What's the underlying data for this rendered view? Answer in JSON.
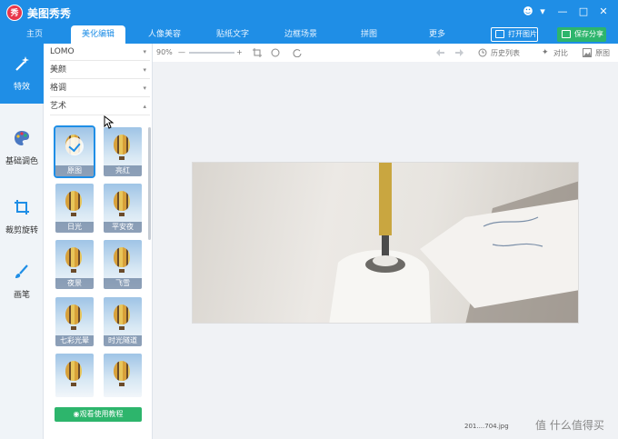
{
  "app": {
    "title": "美图秀秀",
    "logo_text": "秀"
  },
  "window_controls": [
    "☻",
    "▾",
    "—",
    "□",
    "✕"
  ],
  "nav": {
    "tabs": [
      {
        "label": "主页",
        "active": false
      },
      {
        "label": "美化编辑",
        "active": true
      },
      {
        "label": "人像美容",
        "active": false
      },
      {
        "label": "贴纸文字",
        "active": false
      },
      {
        "label": "边框场景",
        "active": false
      },
      {
        "label": "拼图",
        "active": false
      },
      {
        "label": "更多",
        "active": false
      }
    ],
    "open_button": "打开图片",
    "save_button": "保存分享"
  },
  "sidebar": {
    "items": [
      {
        "label": "特效",
        "icon": "magic-wand-icon",
        "active": true
      },
      {
        "label": "基础调色",
        "icon": "palette-icon",
        "active": false
      },
      {
        "label": "裁剪旋转",
        "icon": "crop-icon",
        "active": false
      },
      {
        "label": "画笔",
        "icon": "brush-icon",
        "active": false
      }
    ]
  },
  "panel": {
    "categories": [
      {
        "label": "LOMO",
        "arrow": "▾"
      },
      {
        "label": "美颜",
        "arrow": "▾"
      },
      {
        "label": "格调",
        "arrow": "▾"
      },
      {
        "label": "艺术",
        "arrow": "▴"
      }
    ],
    "effects": [
      {
        "label": "原图",
        "selected": true
      },
      {
        "label": "亮红",
        "selected": false
      },
      {
        "label": "日光",
        "selected": false
      },
      {
        "label": "平安夜",
        "selected": false
      },
      {
        "label": "夜景",
        "selected": false
      },
      {
        "label": "飞雪",
        "selected": false
      },
      {
        "label": "七彩光晕",
        "selected": false
      },
      {
        "label": "时光隧道",
        "selected": false
      },
      {
        "label": "",
        "selected": false
      },
      {
        "label": "",
        "selected": false
      }
    ],
    "tutorial_button": "◉观看使用教程"
  },
  "toolbar": {
    "zoom": "90%",
    "zoom_out": "—",
    "zoom_in": "+",
    "history": "历史列表",
    "compare": "对比",
    "original": "原图"
  },
  "status": {
    "filename": "201....704.jpg"
  },
  "watermark": "值 什么值得买",
  "colors": {
    "brand_blue": "#1f8ee6",
    "accent_green": "#2db56c",
    "logo_red": "#e8364a"
  }
}
